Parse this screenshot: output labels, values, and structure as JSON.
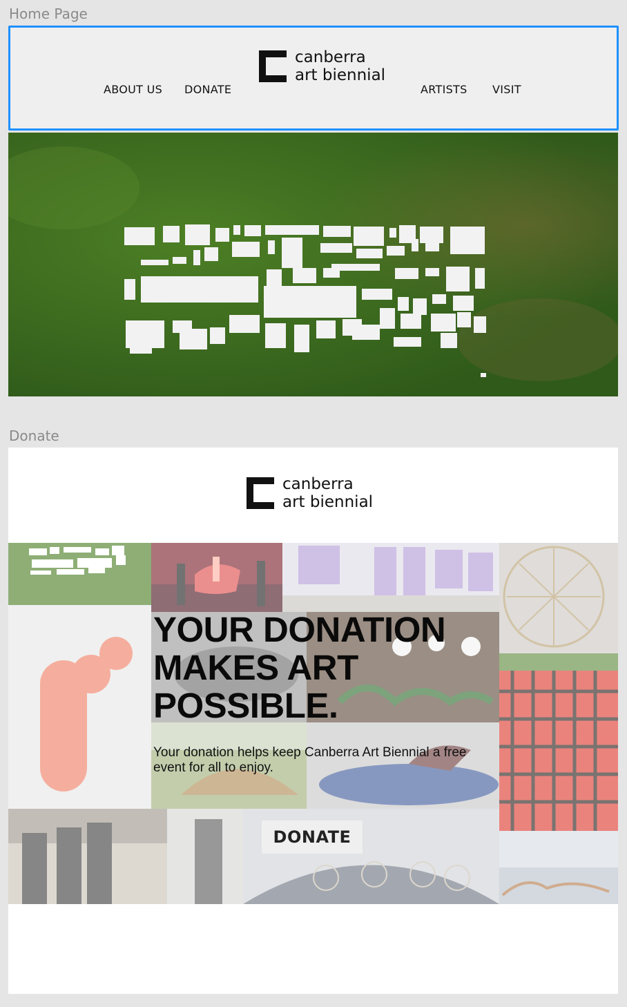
{
  "frames": {
    "home_label": "Home Page",
    "donate_label": "Donate"
  },
  "logo": {
    "line1": "canberra",
    "line2": "art biennial"
  },
  "nav": {
    "about": "ABOUT US",
    "donate": "DONATE",
    "artists": "ARTISTS",
    "visit": "VISIT"
  },
  "donate_page": {
    "headline_1": "YOUR DONATION",
    "headline_2": "MAKES ART",
    "headline_3": "POSSIBLE.",
    "subtext": "Your donation helps keep Canberra Art Biennial a free event for all to enjoy.",
    "button": "DONATE"
  },
  "colors": {
    "selection": "#1e90ff",
    "grass": "#3c6a20",
    "header_bg": "#efefef",
    "text": "#111111"
  }
}
